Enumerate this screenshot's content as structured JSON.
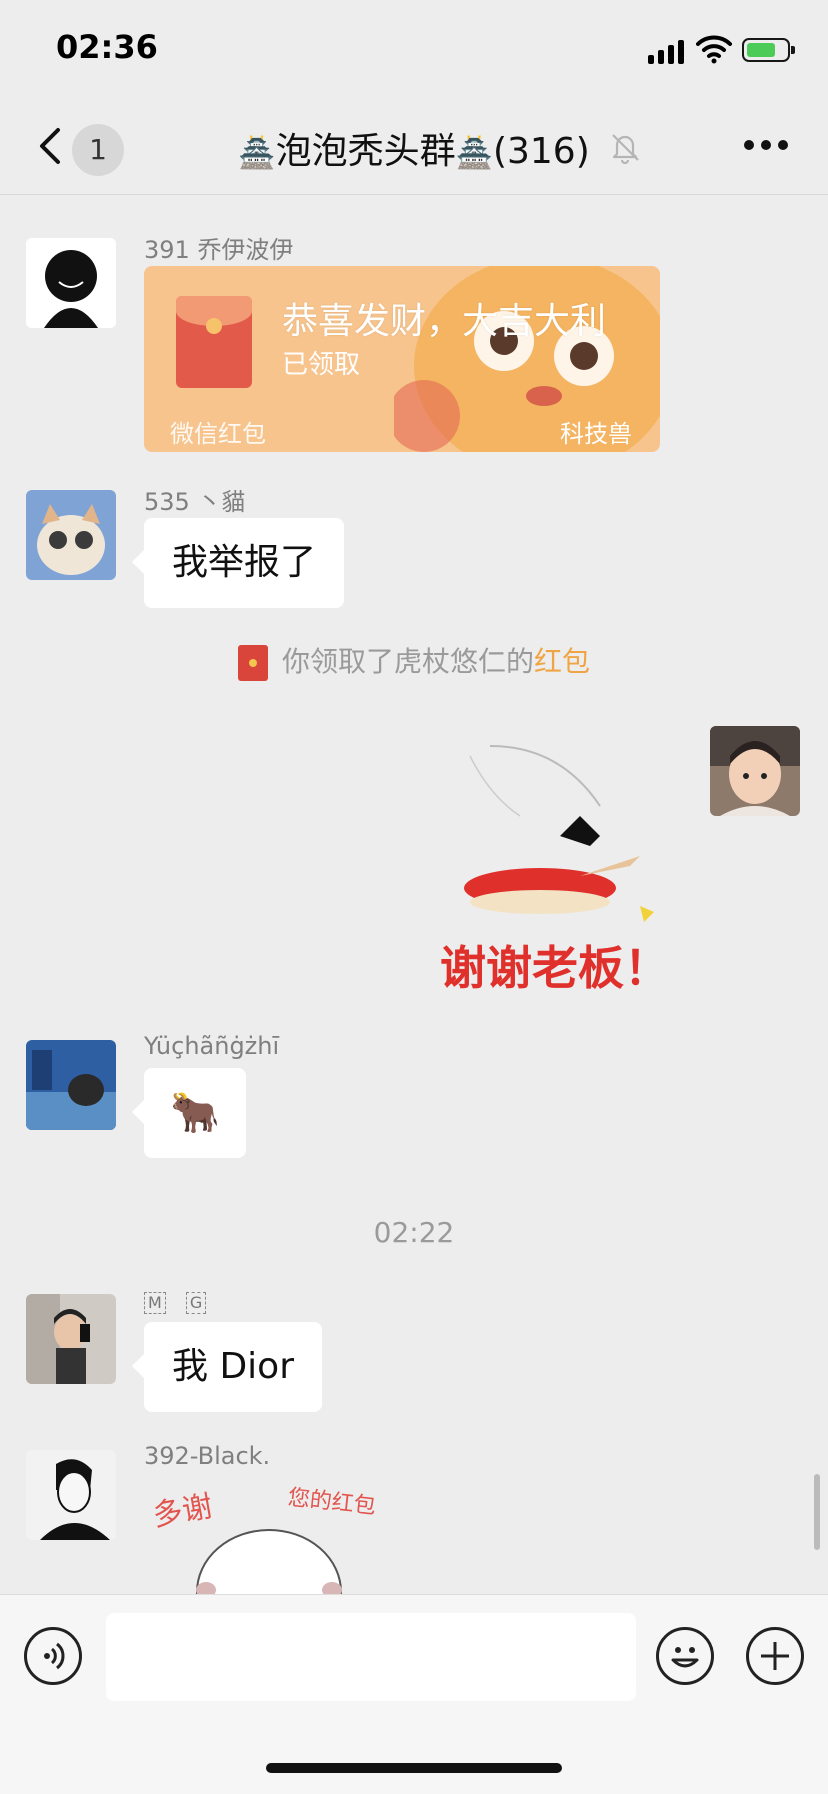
{
  "status_bar": {
    "time": "02:36"
  },
  "nav": {
    "unread_count": "1",
    "title_prefix": "🏯",
    "title_name": "泡泡秃头群",
    "title_suffix": "🏯",
    "member_count": "(316)"
  },
  "messages": [
    {
      "sender": "391 乔伊波伊",
      "type": "red_packet",
      "red_packet": {
        "title": "恭喜发财，大吉大利",
        "status": "已领取",
        "footer": "微信红包",
        "tag": "科技兽"
      }
    },
    {
      "sender": "535 丶貓",
      "type": "text",
      "text": "我举报了"
    },
    {
      "type": "system",
      "text": "你领取了虎杖悠仁的",
      "link": "红包"
    },
    {
      "type": "sticker_self",
      "sticker_text": "谢谢老板！"
    },
    {
      "sender": "Yüçhãñġżhī",
      "type": "emoji",
      "text": "🐂"
    },
    {
      "type": "timestamp",
      "text": "02:22"
    },
    {
      "sender_tags": [
        "M",
        "G"
      ],
      "type": "text",
      "text": "我 Dior"
    },
    {
      "sender": "392-Black.",
      "type": "sticker",
      "sticker_text": [
        "多谢",
        "您的红包"
      ]
    }
  ],
  "colors": {
    "background": "#ededed",
    "red_packet": "#f7c48d",
    "link": "#f0a545",
    "sticker_red": "#e0302c"
  }
}
